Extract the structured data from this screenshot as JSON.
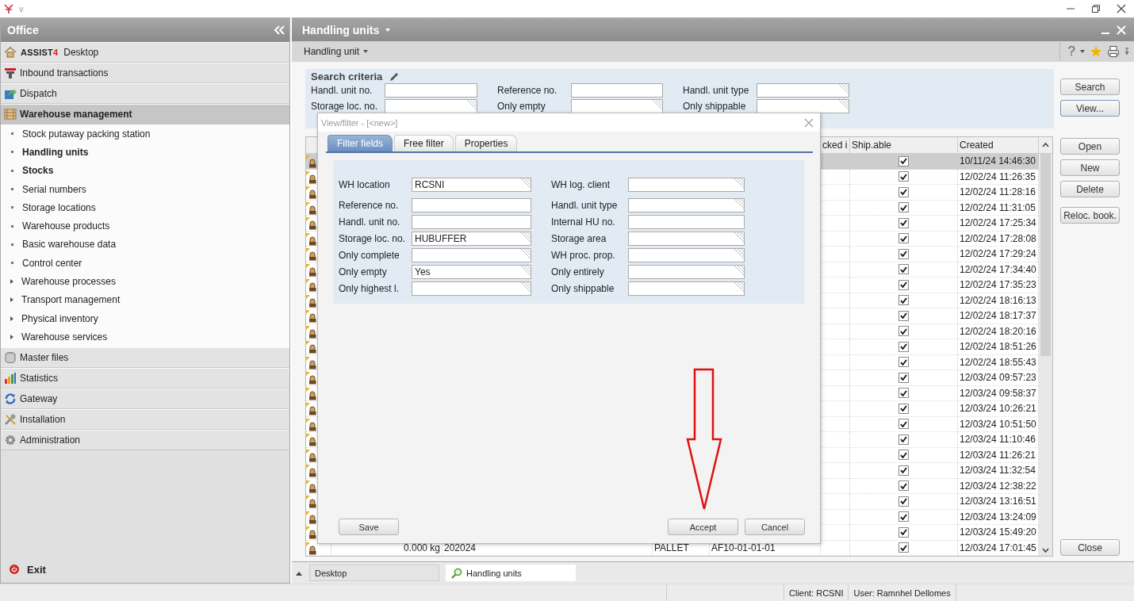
{
  "app_bar": {
    "menu_label": "v"
  },
  "sidebar": {
    "title": "Office",
    "sections": [
      {
        "logo": "ASSIST",
        "logo_suffix": "4",
        "label": "Desktop",
        "selected": false
      },
      {
        "label": "Inbound transactions",
        "selected": false
      },
      {
        "label": "Dispatch",
        "selected": false
      },
      {
        "label": "Warehouse management",
        "selected": true,
        "children": [
          {
            "label": "Stock putaway packing station",
            "bold": false,
            "expandable": false
          },
          {
            "label": "Handling units",
            "bold": true,
            "expandable": false
          },
          {
            "label": "Stocks",
            "bold": true,
            "expandable": false
          },
          {
            "label": "Serial numbers",
            "bold": false,
            "expandable": false
          },
          {
            "label": "Storage locations",
            "bold": false,
            "expandable": false
          },
          {
            "label": "Warehouse products",
            "bold": false,
            "expandable": false
          },
          {
            "label": "Basic warehouse data",
            "bold": false,
            "expandable": false
          },
          {
            "label": "Control center",
            "bold": false,
            "expandable": false
          },
          {
            "label": "Warehouse processes",
            "bold": false,
            "expandable": true
          },
          {
            "label": "Transport management",
            "bold": false,
            "expandable": true
          },
          {
            "label": "Physical inventory",
            "bold": false,
            "expandable": true
          },
          {
            "label": "Warehouse services",
            "bold": false,
            "expandable": true
          }
        ]
      },
      {
        "label": "Master files",
        "selected": false
      },
      {
        "label": "Statistics",
        "selected": false
      },
      {
        "label": "Gateway",
        "selected": false
      },
      {
        "label": "Installation",
        "selected": false
      },
      {
        "label": "Administration",
        "selected": false
      }
    ],
    "exit": "Exit"
  },
  "window": {
    "title": "Handling units",
    "toolbar_menu": "Handling unit",
    "help": "?"
  },
  "search_criteria": {
    "title": "Search criteria",
    "fields": [
      {
        "label": "Handl. unit no.",
        "kind": "text"
      },
      {
        "label": "Reference no.",
        "kind": "text"
      },
      {
        "label": "Handl. unit type",
        "kind": "combo"
      },
      {
        "label": "Storage loc. no.",
        "kind": "combo"
      },
      {
        "label": "Only empty",
        "kind": "combo"
      },
      {
        "label": "Only shippable",
        "kind": "combo"
      }
    ]
  },
  "actions": [
    "Search",
    "View...",
    "Open",
    "New",
    "Delete",
    "Reloc. book."
  ],
  "close_button": "Close",
  "table": {
    "columns": [
      "cked i",
      "Ship.able",
      "Created"
    ],
    "rows": [
      {
        "ship_able": true,
        "created": "10/11/24 14:46:30",
        "selected": true
      },
      {
        "ship_able": true,
        "created": "12/02/24 11:26:35",
        "selected": false
      },
      {
        "ship_able": true,
        "created": "12/02/24 11:28:16",
        "selected": false
      },
      {
        "ship_able": true,
        "created": "12/02/24 11:31:05",
        "selected": false
      },
      {
        "ship_able": true,
        "created": "12/02/24 17:25:34",
        "selected": false
      },
      {
        "ship_able": true,
        "created": "12/02/24 17:28:08",
        "selected": false
      },
      {
        "ship_able": true,
        "created": "12/02/24 17:29:24",
        "selected": false
      },
      {
        "ship_able": true,
        "created": "12/02/24 17:34:40",
        "selected": false
      },
      {
        "ship_able": true,
        "created": "12/02/24 17:35:23",
        "selected": false
      },
      {
        "ship_able": true,
        "created": "12/02/24 18:16:13",
        "selected": false
      },
      {
        "ship_able": true,
        "created": "12/02/24 18:17:37",
        "selected": false
      },
      {
        "ship_able": true,
        "created": "12/02/24 18:20:16",
        "selected": false
      },
      {
        "ship_able": true,
        "created": "12/02/24 18:51:26",
        "selected": false
      },
      {
        "ship_able": true,
        "created": "12/02/24 18:55:43",
        "selected": false
      },
      {
        "ship_able": true,
        "created": "12/03/24 09:57:23",
        "selected": false
      },
      {
        "ship_able": true,
        "created": "12/03/24 09:58:37",
        "selected": false
      },
      {
        "ship_able": true,
        "created": "12/03/24 10:26:21",
        "selected": false
      },
      {
        "ship_able": true,
        "created": "12/03/24 10:51:50",
        "selected": false
      },
      {
        "ship_able": true,
        "created": "12/03/24 11:10:46",
        "selected": false
      },
      {
        "ship_able": true,
        "created": "12/03/24 11:26:21",
        "selected": false
      },
      {
        "ship_able": true,
        "created": "12/03/24 11:32:54",
        "selected": false
      },
      {
        "ship_able": true,
        "created": "12/03/24 12:38:22",
        "selected": false
      },
      {
        "ship_able": true,
        "created": "12/03/24 13:16:51",
        "selected": false
      },
      {
        "ship_able": true,
        "created": "12/03/24 13:24:09",
        "selected": false
      },
      {
        "ship_able": true,
        "created": "12/03/24 15:49:20",
        "selected": false
      },
      {
        "column_2": "0.000 kg",
        "column_3": "202024",
        "column_4": "PALLET",
        "column_5": "AF10-01-01-01",
        "ship_able": true,
        "created": "12/03/24 17:01:45",
        "selected": false
      }
    ]
  },
  "dialog": {
    "title": "View/filter - [<new>]",
    "tabs": [
      {
        "label": "Filter fields",
        "selected": true
      },
      {
        "label": "Free filter",
        "selected": false
      },
      {
        "label": "Properties",
        "selected": false
      }
    ],
    "rows": [
      [
        {
          "label": "WH location",
          "value": "RCSNI",
          "kind": "combo"
        },
        {
          "label": "WH log. client",
          "kind": "combo"
        }
      ],
      [
        {
          "label": "Reference no.",
          "kind": "text"
        },
        {
          "label": "Handl. unit type",
          "kind": "combo"
        }
      ],
      [
        {
          "label": "Handl. unit no.",
          "kind": "text"
        },
        {
          "label": "Internal HU no.",
          "kind": "text"
        }
      ],
      [
        {
          "label": "Storage loc. no.",
          "value": "HUBUFFER",
          "kind": "combo"
        },
        {
          "label": "Storage area",
          "kind": "combo"
        }
      ],
      [
        {
          "label": "Only complete",
          "kind": "combo"
        },
        {
          "label": "WH proc. prop.",
          "kind": "combo"
        }
      ],
      [
        {
          "label": "Only empty",
          "value": "Yes",
          "kind": "combo"
        },
        {
          "label": "Only entirely",
          "kind": "combo"
        }
      ],
      [
        {
          "label": "Only highest l.",
          "kind": "combo"
        },
        {
          "label": "Only shippable",
          "kind": "combo"
        }
      ]
    ],
    "buttons": {
      "save": "Save",
      "accept": "Accept",
      "cancel": "Cancel"
    }
  },
  "bottom_tabs": [
    {
      "label": "Desktop",
      "selected": false
    },
    {
      "label": "Handling units",
      "selected": true
    }
  ],
  "status_bar": [
    "Client: RCSNI",
    "User: Ramnhel Dellomes"
  ]
}
